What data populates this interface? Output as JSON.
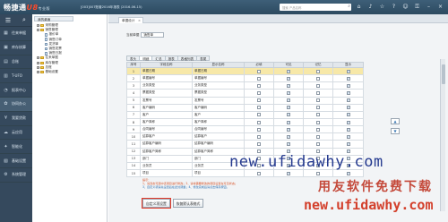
{
  "app": {
    "logo_text": "畅捷通",
    "logo_u8": "U8",
    "logo_edition": "专业版",
    "title_info": "[003]007账套2016年报表   (2016-06-15)",
    "search_placeholder": "搜索 产品名称"
  },
  "titlebar_icons": [
    "home-icon",
    "bell-icon",
    "star-icon",
    "help-icon",
    "user-icon",
    "lock-icon",
    "minimize-icon",
    "close-icon"
  ],
  "nav": {
    "items": [
      {
        "icon": "grid-icon",
        "label": "往来单据"
      },
      {
        "icon": "box-icon",
        "label": "库存核算"
      },
      {
        "icon": "chart-icon",
        "label": "总账"
      },
      {
        "icon": "report-icon",
        "label": "T-UFO"
      },
      {
        "icon": "gauge-icon",
        "label": "报表中心"
      },
      {
        "icon": "cog-icon",
        "label": "协同办公"
      },
      {
        "icon": "money-icon",
        "label": "我要贷款"
      },
      {
        "icon": "cloud-icon",
        "label": "云应用"
      },
      {
        "icon": "bulb-icon",
        "label": "智能化"
      },
      {
        "icon": "data-icon",
        "label": "基础设置"
      },
      {
        "icon": "sys-icon",
        "label": "系统管理"
      }
    ],
    "active_index": 5
  },
  "tree": {
    "tab_label": "我的桌面",
    "nodes": [
      {
        "label": "采购管理",
        "level": 1,
        "type": "folder",
        "toggle": "+"
      },
      {
        "label": "销售管理",
        "level": 1,
        "type": "folder",
        "toggle": "-"
      },
      {
        "label": "报价单",
        "level": 2,
        "type": "doc"
      },
      {
        "label": "销售订单",
        "level": 2,
        "type": "doc"
      },
      {
        "label": "发货单",
        "level": 2,
        "type": "doc"
      },
      {
        "label": "销售发票",
        "level": 2,
        "type": "doc"
      },
      {
        "label": "销售日报",
        "level": 2,
        "type": "doc"
      },
      {
        "label": "往来单据",
        "level": 1,
        "type": "folder",
        "toggle": "+"
      },
      {
        "label": "库存管理",
        "level": 1,
        "type": "folder",
        "toggle": "+"
      },
      {
        "label": "总账",
        "level": 1,
        "type": "folder",
        "toggle": "+"
      },
      {
        "label": "基础设置",
        "level": 1,
        "type": "folder",
        "toggle": "+"
      }
    ]
  },
  "dialog": {
    "tab_label": "单据设计",
    "name_label": "当前单据",
    "name_value": "销售单",
    "subtabs": [
      "表头",
      "明细",
      "汇总",
      "报表",
      "表格列表",
      "表尾"
    ],
    "active_subtab": 1,
    "columns": [
      "序号",
      "字段名称",
      "显示名称",
      "必填",
      "可见",
      "记忆",
      "显示"
    ],
    "rows": [
      {
        "no": "1",
        "field": "单据日期",
        "display": "单据日期",
        "c1": false,
        "c2": true,
        "c3": false,
        "c4": true
      },
      {
        "no": "2",
        "field": "单据编号",
        "display": "单据编号",
        "c1": false,
        "c2": true,
        "c3": false,
        "c4": true
      },
      {
        "no": "3",
        "field": "业务类型",
        "display": "业务类型",
        "c1": false,
        "c2": true,
        "c3": false,
        "c4": true
      },
      {
        "no": "4",
        "field": "票据类型",
        "display": "票据类型",
        "c1": false,
        "c2": true,
        "c3": false,
        "c4": true
      },
      {
        "no": "5",
        "field": "发票号",
        "display": "发票号",
        "c1": false,
        "c2": true,
        "c3": false,
        "c4": true
      },
      {
        "no": "6",
        "field": "客户编码",
        "display": "客户编码",
        "c1": false,
        "c2": true,
        "c3": false,
        "c4": true
      },
      {
        "no": "7",
        "field": "客户",
        "display": "客户",
        "c1": false,
        "c2": true,
        "c3": false,
        "c4": true
      },
      {
        "no": "8",
        "field": "客户简称",
        "display": "客户简称",
        "c1": false,
        "c2": true,
        "c3": false,
        "c4": true
      },
      {
        "no": "9",
        "field": "合同编号",
        "display": "合同编号",
        "c1": false,
        "c2": true,
        "c3": false,
        "c4": true
      },
      {
        "no": "10",
        "field": "结算客户",
        "display": "结算客户",
        "c1": false,
        "c2": true,
        "c3": false,
        "c4": true
      },
      {
        "no": "11",
        "field": "结算客户编码",
        "display": "结算客户编码",
        "c1": false,
        "c2": true,
        "c3": false,
        "c4": true
      },
      {
        "no": "12",
        "field": "结算客户简称",
        "display": "结算客户简称",
        "c1": false,
        "c2": true,
        "c3": false,
        "c4": true
      },
      {
        "no": "13",
        "field": "部门",
        "display": "部门",
        "c1": false,
        "c2": true,
        "c3": false,
        "c4": true
      },
      {
        "no": "14",
        "field": "业务员",
        "display": "业务员",
        "c1": false,
        "c2": true,
        "c3": false,
        "c4": true
      },
      {
        "no": "15",
        "field": "项目",
        "display": "项目",
        "c1": false,
        "c2": true,
        "c3": false,
        "c4": true
      }
    ],
    "selected_row": 0,
    "notice_line1": "提示：",
    "notice_line2": "1、请双击可选中该项目进行修改；2、请将需要修改的项目设置在可见状态；",
    "notice_line3": "3、自定义项请先设置后在此处调整；4、修改完成后请点击保存按钮。",
    "btn_custom": "自定义项设置",
    "btn_restore": "恢复默认表格式",
    "move_up": "▲",
    "move_down": "▼"
  },
  "watermark": {
    "line1": "new.ufidawhy.com",
    "line2": "用友软件免费下载",
    "line3": "new.ufidawhy.com"
  }
}
